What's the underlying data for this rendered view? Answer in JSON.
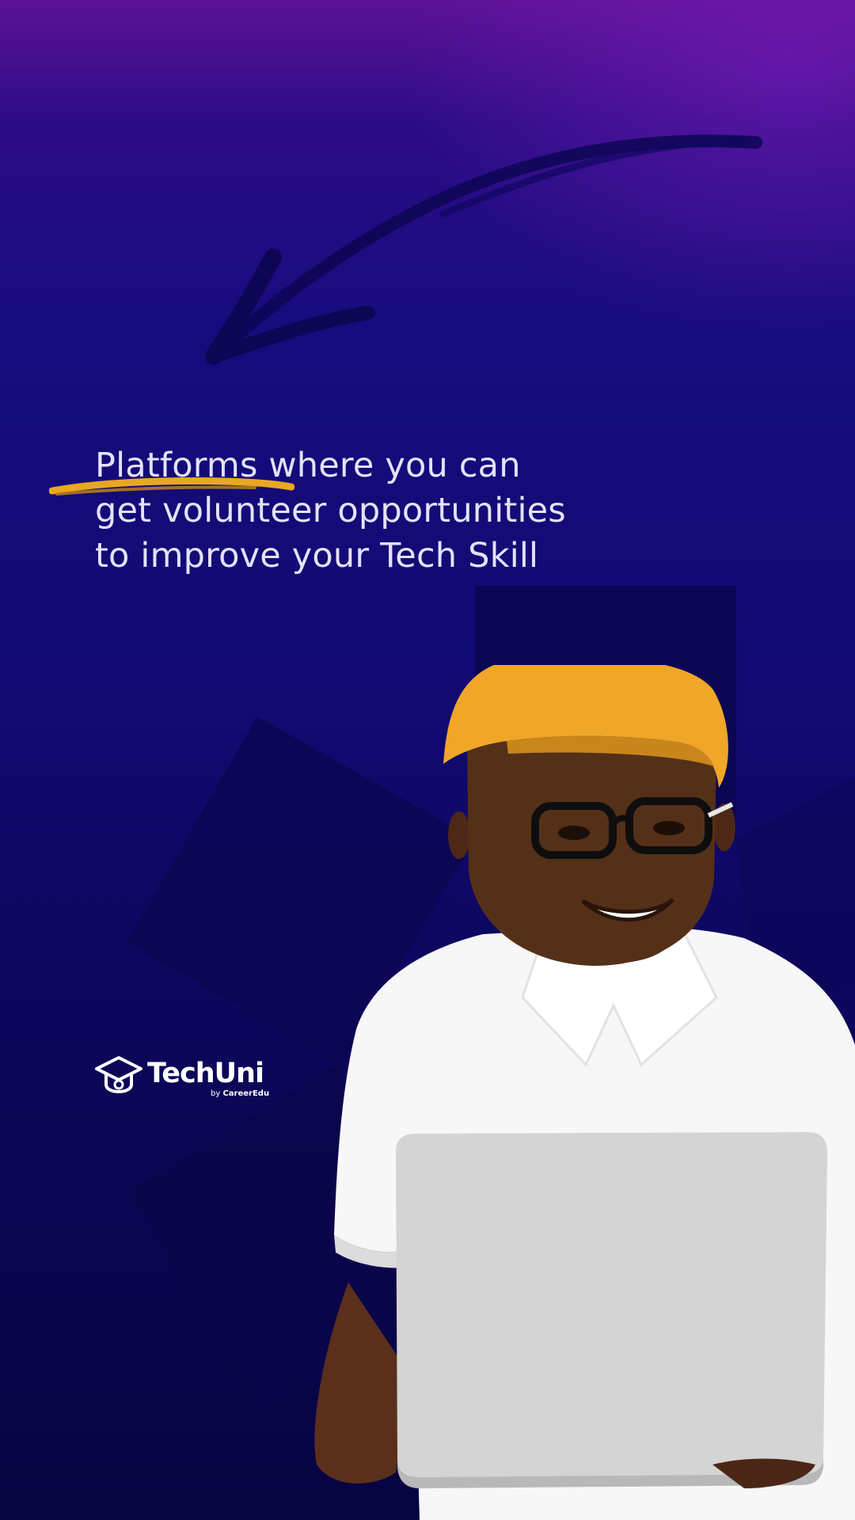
{
  "headline": {
    "line1": "Platforms where you can",
    "line2": "get volunteer opportunities",
    "line3": "to improve your Tech Skill"
  },
  "logo": {
    "name": "TechUni",
    "by": "by",
    "parent": "CareerEdu"
  },
  "icons": {
    "arrow": "arrow-down-left-brush-icon",
    "brand": "graduation-cap-icon"
  },
  "colors": {
    "accent": "#e8a820",
    "text": "#e4e2f8",
    "background_top": "#5c1296",
    "background_bottom": "#070340",
    "cap": "#f0a628",
    "shirt": "#ffffff",
    "laptop": "#d4d4d4"
  }
}
